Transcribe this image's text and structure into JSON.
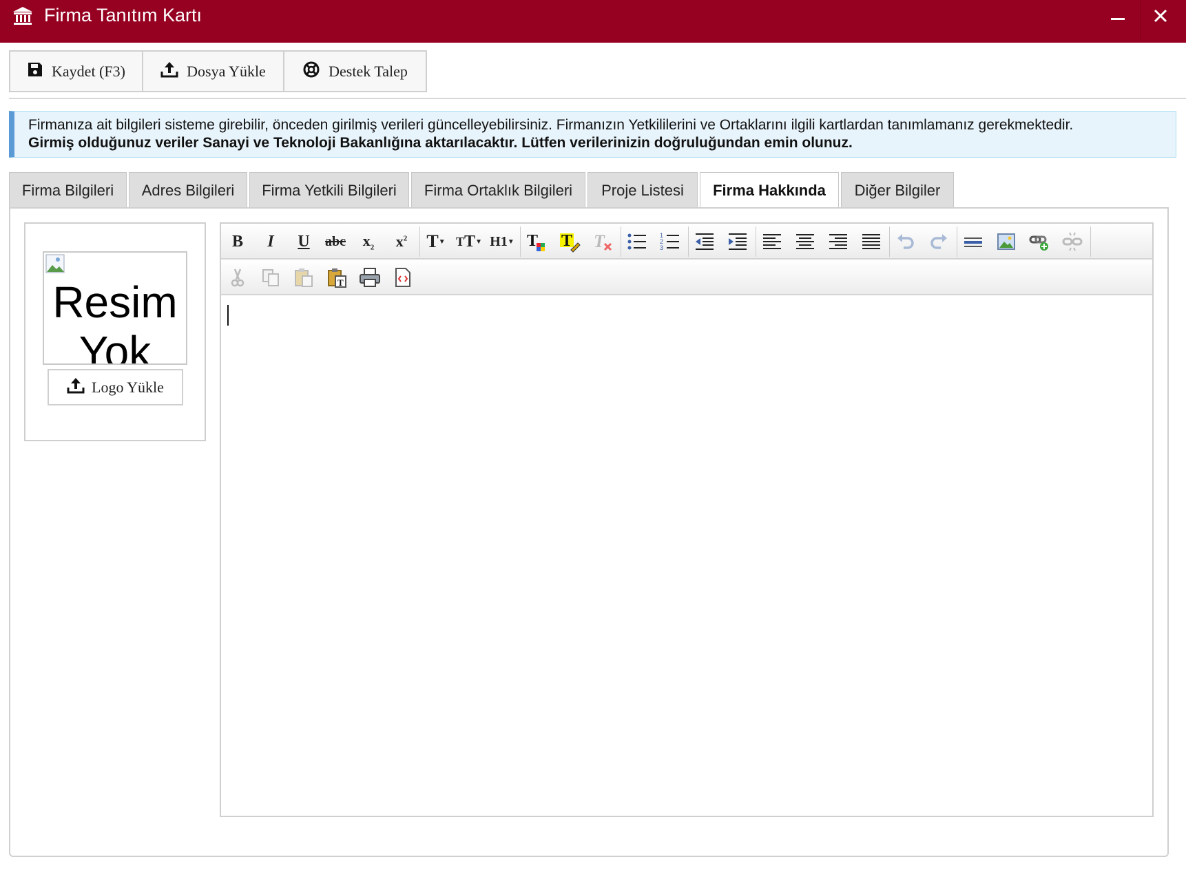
{
  "window": {
    "title": "Firma Tanıtım Kartı",
    "icon": "bank-building-icon",
    "controls": [
      "minimize-icon",
      "close-icon"
    ],
    "accent_color": "#960021"
  },
  "toolbar": {
    "save_label": "Kaydet (F3)",
    "upload_label": "Dosya Yükle",
    "support_label": "Destek Talep"
  },
  "alert": {
    "line1": "Firmanıza ait bilgileri sisteme girebilir, önceden girilmiş verileri güncelleyebilirsiniz. Firmanızın Yetkililerini ve Ortaklarını ilgili kartlardan tanımlamanız gerekmektedir.",
    "line2": "Girmiş olduğunuz veriler Sanayi ve Teknoloji Bakanlığına aktarılacaktır. Lütfen verilerinizin doğruluğundan emin olunuz."
  },
  "tabs": [
    {
      "label": "Firma Bilgileri",
      "active": false
    },
    {
      "label": "Adres Bilgileri",
      "active": false
    },
    {
      "label": "Firma Yetkili Bilgileri",
      "active": false
    },
    {
      "label": "Firma Ortaklık Bilgileri",
      "active": false
    },
    {
      "label": "Proje Listesi",
      "active": false
    },
    {
      "label": "Firma Hakkında",
      "active": true
    },
    {
      "label": "Diğer Bilgiler",
      "active": false
    }
  ],
  "logo": {
    "alt_text": "Resim Yok",
    "upload_label": "Logo Yükle"
  },
  "editor": {
    "toolbar_row1": [
      "bold-icon",
      "italic-icon",
      "underline-icon",
      "strikethrough-icon",
      "subscript-icon",
      "superscript-icon",
      "font-name-icon",
      "font-size-icon",
      "heading-icon",
      "font-color-icon",
      "highlight-icon",
      "clear-format-icon",
      "bullet-list-icon",
      "numbered-list-icon",
      "outdent-icon",
      "indent-icon",
      "align-left-icon",
      "align-center-icon",
      "align-right-icon",
      "justify-icon",
      "undo-icon",
      "redo-icon",
      "horizontal-rule-icon",
      "insert-image-icon",
      "insert-link-icon",
      "unlink-icon"
    ],
    "toolbar_row2": [
      "cut-icon",
      "copy-icon",
      "paste-icon",
      "paste-text-icon",
      "print-icon",
      "source-code-icon"
    ],
    "content": ""
  }
}
